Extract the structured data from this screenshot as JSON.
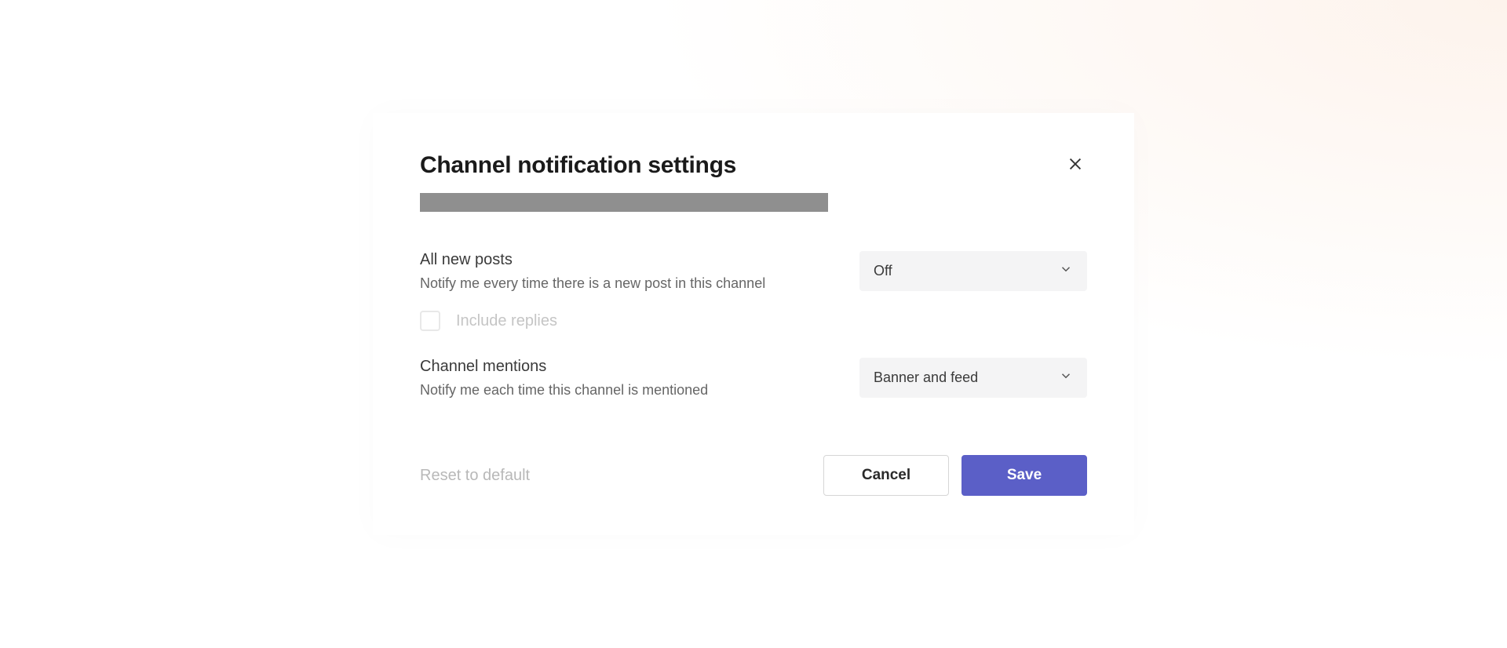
{
  "dialog": {
    "title": "Channel notification settings"
  },
  "settings": {
    "all_new_posts": {
      "label": "All new posts",
      "description": "Notify me every time there is a new post in this channel",
      "value": "Off"
    },
    "include_replies": {
      "label": "Include replies",
      "checked": false
    },
    "channel_mentions": {
      "label": "Channel mentions",
      "description": "Notify me each time this channel is mentioned",
      "value": "Banner and feed"
    }
  },
  "footer": {
    "reset": "Reset to default",
    "cancel": "Cancel",
    "save": "Save"
  }
}
